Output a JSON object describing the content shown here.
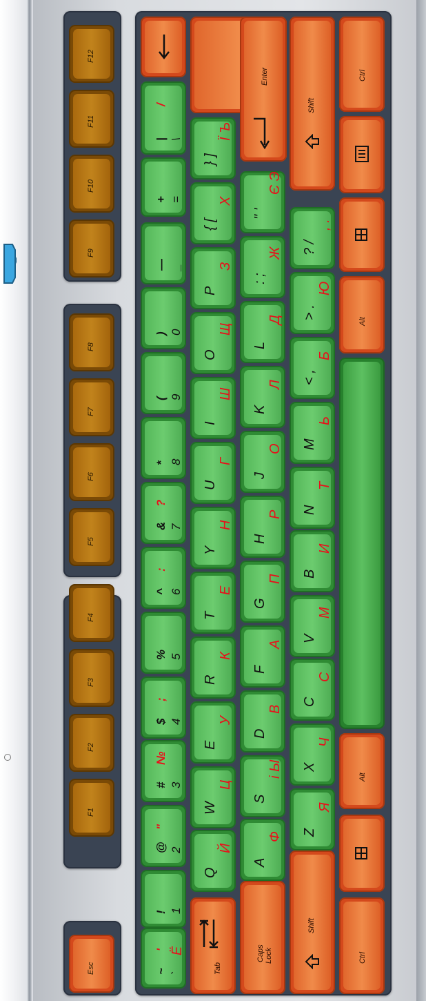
{
  "function_keys": [
    "F1",
    "F2",
    "F3",
    "F4",
    "F5",
    "F6",
    "F7",
    "F8",
    "F9",
    "F10",
    "F11",
    "F12"
  ],
  "esc": "Esc",
  "tab": "Tab",
  "caps": [
    "Caps",
    "Lock"
  ],
  "shift": "Shift",
  "ctrl": "Ctrl",
  "alt": "Alt",
  "enter": "Enter",
  "number_row": [
    {
      "top": "~",
      "top_ru": "'",
      "bottom": "`",
      "bottom_ru": "Ё"
    },
    {
      "top": "!",
      "bottom": "1"
    },
    {
      "top": "@",
      "top2": "\"",
      "bottom": "2"
    },
    {
      "top": "#",
      "top2": "№",
      "bottom": "3"
    },
    {
      "top": "$",
      "top2": ";",
      "bottom": "4"
    },
    {
      "top": "%",
      "bottom": "5"
    },
    {
      "top": "^",
      "top2": ":",
      "bottom": "6"
    },
    {
      "top": "&",
      "top2": "?",
      "bottom": "7"
    },
    {
      "top": "*",
      "bottom": "8"
    },
    {
      "top": "(",
      "bottom": "9"
    },
    {
      "top": ")",
      "bottom": "0"
    },
    {
      "top": "—",
      "bottom": "_"
    },
    {
      "top": "+",
      "bottom": "="
    },
    {
      "top": "|",
      "top2": "/",
      "bottom": "\\"
    }
  ],
  "q_row": [
    {
      "lat": "Q",
      "ru": "Й"
    },
    {
      "lat": "W",
      "ru": "Ц"
    },
    {
      "lat": "E",
      "ru": "У"
    },
    {
      "lat": "R",
      "ru": "К"
    },
    {
      "lat": "T",
      "ru": "Е"
    },
    {
      "lat": "Y",
      "ru": "Н"
    },
    {
      "lat": "U",
      "ru": "Г"
    },
    {
      "lat": "I",
      "ru": "Ш"
    },
    {
      "lat": "O",
      "ru": "Щ"
    },
    {
      "lat": "P",
      "ru": "З"
    },
    {
      "lat": "{ [",
      "ru": "Х"
    },
    {
      "lat": "} ]",
      "ru": "Ї Ъ"
    }
  ],
  "a_row": [
    {
      "lat": "A",
      "ru": "Ф"
    },
    {
      "lat": "S",
      "ru": "і Ы"
    },
    {
      "lat": "D",
      "ru": "В"
    },
    {
      "lat": "F",
      "ru": "А"
    },
    {
      "lat": "G",
      "ru": "П"
    },
    {
      "lat": "H",
      "ru": "Р"
    },
    {
      "lat": "J",
      "ru": "О"
    },
    {
      "lat": "K",
      "ru": "Л"
    },
    {
      "lat": "L",
      "ru": "Д"
    },
    {
      "lat": ": ;",
      "ru": "Ж"
    },
    {
      "lat": "\" '",
      "ru": "Є Э"
    }
  ],
  "z_row": [
    {
      "lat": "Z",
      "ru": "Я"
    },
    {
      "lat": "X",
      "ru": "Ч"
    },
    {
      "lat": "C",
      "ru": "С"
    },
    {
      "lat": "V",
      "ru": "М"
    },
    {
      "lat": "B",
      "ru": "И"
    },
    {
      "lat": "N",
      "ru": "Т"
    },
    {
      "lat": "M",
      "ru": "Ь"
    },
    {
      "lat": "< ,",
      "ru": "Б"
    },
    {
      "lat": "> .",
      "ru": "Ю"
    },
    {
      "lat": "? /",
      "ru": ", ."
    }
  ]
}
